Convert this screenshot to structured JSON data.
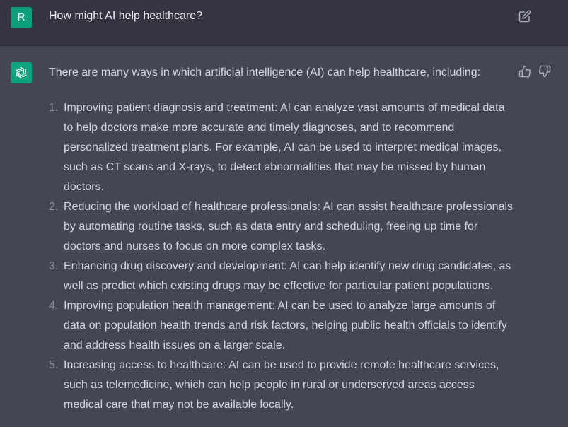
{
  "user": {
    "avatar_letter": "R",
    "message": "How might AI help healthcare?"
  },
  "assistant": {
    "intro": "There are many ways in which artificial intelligence (AI) can help healthcare, including:",
    "items": [
      {
        "number": "1.",
        "text": "Improving patient diagnosis and treatment: AI can analyze vast amounts of medical data to help doctors make more accurate and timely diagnoses, and to recommend personalized treatment plans. For example, AI can be used to interpret medical images, such as CT scans and X-rays, to detect abnormalities that may be missed by human doctors."
      },
      {
        "number": "2.",
        "text": "Reducing the workload of healthcare professionals: AI can assist healthcare professionals by automating routine tasks, such as data entry and scheduling, freeing up time for doctors and nurses to focus on more complex tasks."
      },
      {
        "number": "3.",
        "text": "Enhancing drug discovery and development: AI can help identify new drug candidates, as well as predict which existing drugs may be effective for particular patient populations."
      },
      {
        "number": "4.",
        "text": "Improving population health management: AI can be used to analyze large amounts of data on population health trends and risk factors, helping public health officials to identify and address health issues on a larger scale."
      },
      {
        "number": "5.",
        "text": "Increasing access to healthcare: AI can be used to provide remote healthcare services, such as telemedicine, which can help people in rural or underserved areas access medical care that may not be available locally."
      }
    ]
  },
  "icons": {
    "edit": "edit-icon",
    "thumbs_up": "thumbs-up-icon",
    "thumbs_down": "thumbs-down-icon",
    "assistant_logo": "openai-logo-icon"
  },
  "colors": {
    "user_bg": "#343541",
    "assistant_bg": "#444654",
    "user_avatar": "#0d9e7a",
    "assistant_avatar": "#10a37f"
  }
}
